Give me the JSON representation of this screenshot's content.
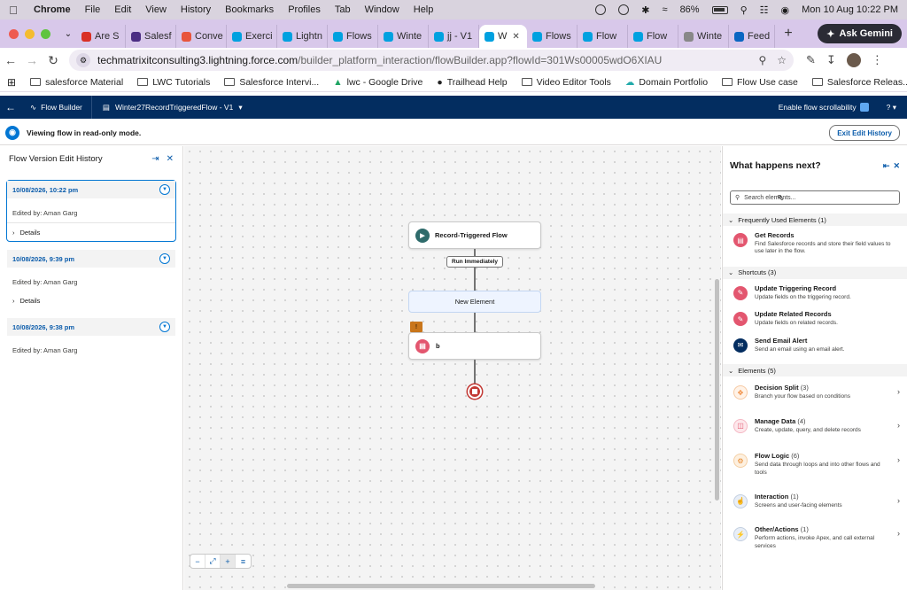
{
  "menubar": {
    "items": [
      "Chrome",
      "File",
      "Edit",
      "View",
      "History",
      "Bookmarks",
      "Profiles",
      "Tab",
      "Window",
      "Help"
    ],
    "battery": "86%",
    "clock": "Mon 10 Aug  10:22 PM"
  },
  "tabs": [
    {
      "label": "Are S",
      "color": "#d93025"
    },
    {
      "label": "Salesf",
      "color": "#4b2d83"
    },
    {
      "label": "Conve",
      "color": "#e8553c"
    },
    {
      "label": "Exerci",
      "color": "#00a1e0"
    },
    {
      "label": "Lightn",
      "color": "#00a1e0"
    },
    {
      "label": "Flows",
      "color": "#00a1e0"
    },
    {
      "label": "Winte",
      "color": "#00a1e0"
    },
    {
      "label": "jj - V1",
      "color": "#00a1e0"
    },
    {
      "label": "W",
      "color": "#00a1e0",
      "active": true
    },
    {
      "label": "Flows",
      "color": "#00a1e0"
    },
    {
      "label": "Flow",
      "color": "#00a1e0"
    },
    {
      "label": "Flow",
      "color": "#00a1e0"
    },
    {
      "label": "Winte",
      "color": "#888888"
    },
    {
      "label": "Feed",
      "color": "#0a66c2"
    }
  ],
  "gemini_label": "Ask Gemini",
  "address": {
    "host": "techmatrixitconsulting3.lightning.force.com",
    "path": "/builder_platform_interaction/flowBuilder.app?flowId=301Ws00005wdO6XIAU"
  },
  "bookmarks": [
    "salesforce Material",
    "LWC Tutorials",
    "Salesforce Intervi...",
    "lwc - Google Drive",
    "Trailhead Help",
    "Video Editor Tools",
    "Domain Portfolio",
    "Flow Use case",
    "Salesforce Releas..."
  ],
  "sf_header": {
    "app": "Flow Builder",
    "flow_name": "Winter27RecordTriggeredFlow - V1",
    "toggle_label": "Enable flow scrollability",
    "help": "?"
  },
  "banner": {
    "text": "Viewing flow in read-only mode.",
    "exit_label": "Exit Edit History"
  },
  "left_panel": {
    "title": "Flow Version Edit History",
    "versions": [
      {
        "date": "10/08/2026, 10:22 pm",
        "edited_by": "Edited by: Aman Garg",
        "details": "Details"
      },
      {
        "date": "10/08/2026, 9:39 pm",
        "edited_by": "Edited by: Aman Garg",
        "details": "Details"
      },
      {
        "date": "10/08/2026, 9:38 pm",
        "edited_by": "Edited by: Aman Garg"
      }
    ]
  },
  "canvas": {
    "start_node": "Record-Triggered Flow",
    "run_label": "Run Immediately",
    "new_element": "New Element",
    "element_b": "b",
    "warn_glyph": "!"
  },
  "right_panel": {
    "title": "What happens next?",
    "search_placeholder": "Search elements...",
    "sections": [
      {
        "label": "Frequently Used Elements (1)",
        "items": [
          {
            "title": "Get Records",
            "desc": "Find Salesforce records and store their field values to use later in the flow.",
            "icon_color": "#e3566f"
          }
        ]
      },
      {
        "label": "Shortcuts (3)",
        "items": [
          {
            "title": "Update Triggering Record",
            "desc": "Update fields on the triggering record.",
            "icon_color": "#e3566f"
          },
          {
            "title": "Update Related Records",
            "desc": "Update fields on related records.",
            "icon_color": "#e3566f"
          },
          {
            "title": "Send Email Alert",
            "desc": "Send an email using an email alert.",
            "icon_color": "#032d60"
          }
        ]
      },
      {
        "label": "Elements (5)",
        "items": [
          {
            "title": "Decision Split",
            "count": "(3)",
            "desc": "Branch your flow based on conditions",
            "icon_color": "#f08a3c"
          },
          {
            "title": "Manage Data",
            "count": "(4)",
            "desc": "Create, update, query, and delete records",
            "icon_color": "#e3566f"
          },
          {
            "title": "Flow Logic",
            "count": "(6)",
            "desc": "Send data through loops and into other flows and tools",
            "icon_color": "#e8862a"
          },
          {
            "title": "Interaction",
            "count": "(1)",
            "desc": "Screens and user-facing elements",
            "icon_color": "#032d60"
          },
          {
            "title": "Other/Actions",
            "count": "(1)",
            "desc": "Perform actions, invoke Apex, and call external services",
            "icon_color": "#032d60"
          }
        ]
      }
    ]
  }
}
